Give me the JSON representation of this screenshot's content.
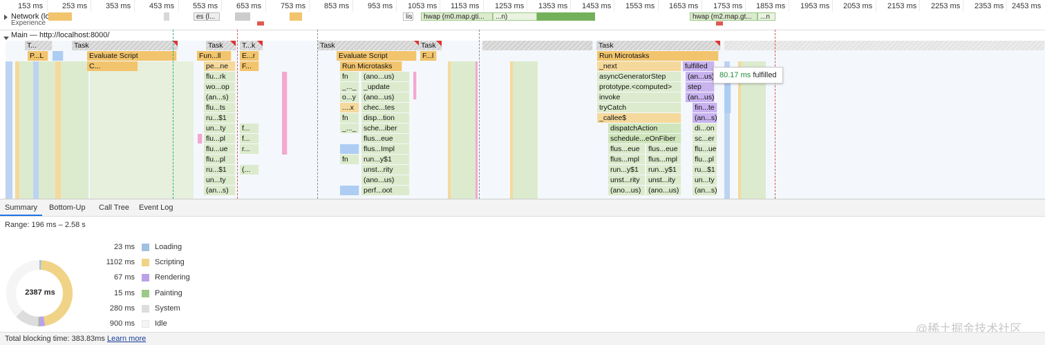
{
  "ruler": {
    "ticks": [
      "153 ms",
      "253 ms",
      "353 ms",
      "453 ms",
      "553 ms",
      "653 ms",
      "753 ms",
      "853 ms",
      "953 ms",
      "1053 ms",
      "1153 ms",
      "1253 ms",
      "1353 ms",
      "1453 ms",
      "1553 ms",
      "1653 ms",
      "1753 ms",
      "1853 ms",
      "1953 ms",
      "2053 ms",
      "2153 ms",
      "2253 ms",
      "2353 ms",
      "2453 ms"
    ]
  },
  "tracks": {
    "network_label": "Network (loc",
    "experience_label": "Experience",
    "main_label": "Main — http://localhost:8000/",
    "net_items": [
      "es (l...",
      "lis",
      "hwap (m0.map.gti...",
      "...n)",
      "hwap (m2.map.gt...",
      "...n"
    ]
  },
  "flame": {
    "row0": [
      "T...",
      "Task",
      "Task",
      "T...k",
      "Task",
      "Task",
      "Task",
      "Task"
    ],
    "row1": [
      "P...L",
      "Evaluate Script",
      "Fun...ll",
      "E...r",
      "Evaluate Script",
      "F...l",
      "Run Microtasks"
    ],
    "row2": [
      "C...",
      "pe...ne",
      "F...",
      "Run Microtasks",
      "_next",
      "fulfilled"
    ],
    "col_a": [
      "flu...rk",
      "wo...op",
      "(an...s)",
      "flu...ts",
      "ru...$1",
      "un...ty",
      "flu...pl",
      "flu...ue",
      "flu...pl",
      "ru...$1",
      "un...ty",
      "(an...s)"
    ],
    "col_b": [
      "f...",
      "f...",
      "r...",
      "(..."
    ],
    "col_c_left": [
      "fn",
      "_..._",
      "o...y",
      "....x",
      "fn",
      "_..._",
      "",
      "",
      "fn"
    ],
    "col_c_right": [
      "(ano...us)",
      "_update",
      "(ano...us)",
      "chec...tes",
      "disp...tion",
      "sche...iber",
      "flus...eue",
      "flus...Impl",
      "run...y$1",
      "unst...rity",
      "(ano...us)",
      "perf...oot"
    ],
    "col_d": [
      "asyncGeneratorStep",
      "prototype.<computed>",
      "invoke",
      "tryCatch",
      "_callee$",
      "dispatchAction",
      "schedule...eOnFiber"
    ],
    "col_d2a": [
      "flus...eue",
      "flus...mpl",
      "run...y$1",
      "unst...rity",
      "(ano...us)"
    ],
    "col_d2b": [
      "flus...eue",
      "flus...mpl",
      "run...y$1",
      "unst...ity",
      "(ano...us)"
    ],
    "col_e": [
      "(an...us)",
      "step",
      "(an...us)",
      "fin...te",
      "(an...s)",
      "di...on",
      "sc...er",
      "flu...ue",
      "flu...pl",
      "ru...$1",
      "un...ty",
      "(an...s)"
    ]
  },
  "tooltip": {
    "duration": "80.17 ms",
    "label": "fulfilled"
  },
  "tabs": [
    "Summary",
    "Bottom-Up",
    "Call Tree",
    "Event Log"
  ],
  "summary": {
    "range": "Range: 196 ms – 2.58 s",
    "total": "2387 ms",
    "legend": [
      {
        "value": "23 ms",
        "name": "Loading",
        "color": "#a1bfe2"
      },
      {
        "value": "1102 ms",
        "name": "Scripting",
        "color": "#f0d386"
      },
      {
        "value": "67 ms",
        "name": "Rendering",
        "color": "#b9a2e9"
      },
      {
        "value": "15 ms",
        "name": "Painting",
        "color": "#9bc987"
      },
      {
        "value": "280 ms",
        "name": "System",
        "color": "#dddddd"
      },
      {
        "value": "900 ms",
        "name": "Idle",
        "color": "#f5f5f5"
      }
    ]
  },
  "footer": {
    "tbt": "Total blocking time: 383.83ms",
    "learn_more": "Learn more"
  },
  "watermark": "@稀土掘金技术社区"
}
